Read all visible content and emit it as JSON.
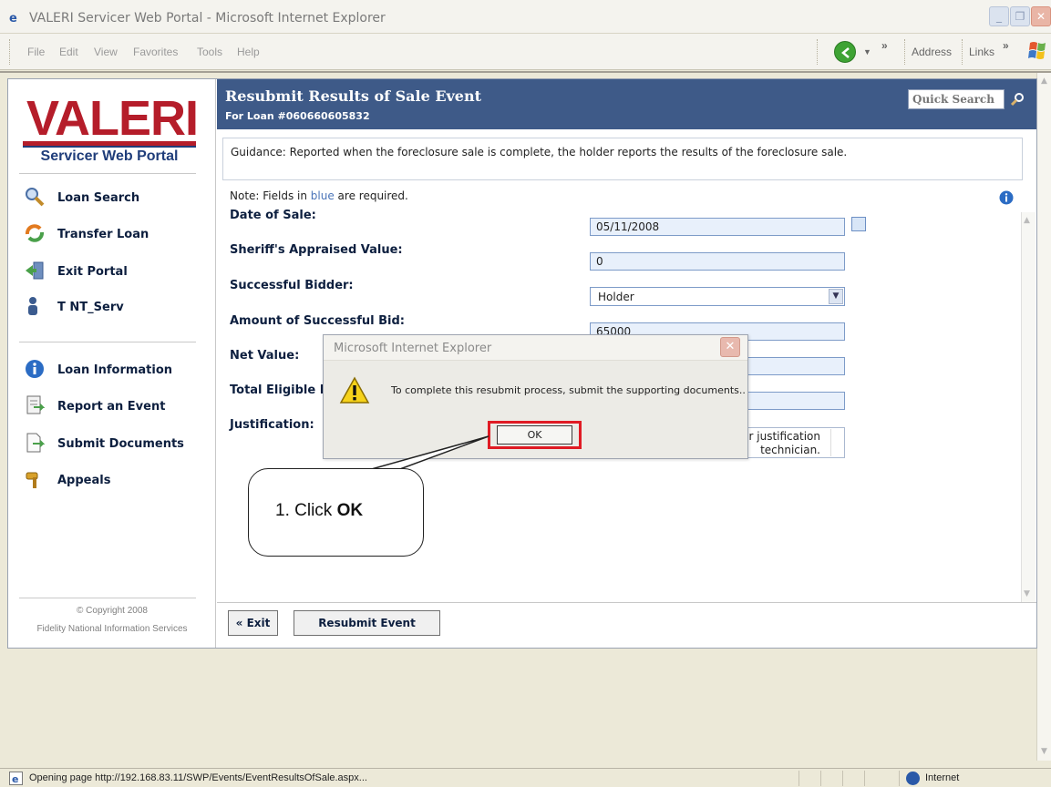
{
  "window": {
    "title": "VALERI Servicer Web Portal - Microsoft Internet Explorer"
  },
  "menubar": {
    "items": [
      "File",
      "Edit",
      "View",
      "Favorites",
      "Tools",
      "Help"
    ],
    "chevron": "»",
    "address_label": "Address",
    "links_label": "Links"
  },
  "sidebar": {
    "logo_text": "VALERI",
    "logo_subtitle": "Servicer Web Portal",
    "nav_top": [
      {
        "label": "Loan Search",
        "icon": "magnifier-icon"
      },
      {
        "label": "Transfer Loan",
        "icon": "transfer-icon"
      },
      {
        "label": "Exit Portal",
        "icon": "exit-icon"
      },
      {
        "label": "T NT_Serv",
        "icon": "user-icon"
      }
    ],
    "nav_bottom": [
      {
        "label": "Loan Information",
        "icon": "info-icon"
      },
      {
        "label": "Report an Event",
        "icon": "report-icon"
      },
      {
        "label": "Submit Documents",
        "icon": "document-icon"
      },
      {
        "label": "Appeals",
        "icon": "gavel-icon"
      }
    ],
    "copyright_line1": "© Copyright 2008",
    "copyright_line2": "Fidelity National Information Services"
  },
  "header": {
    "title": "Resubmit Results of Sale Event",
    "subtitle": "For Loan #060660605832",
    "quick_search_placeholder": "Quick Search"
  },
  "guidance": "Guidance: Reported when the foreclosure sale is complete, the holder reports the results of the foreclosure sale.",
  "note": {
    "prefix": "Note: Fields in ",
    "blue_word": "blue",
    "suffix": " are required."
  },
  "form": {
    "date_of_sale": {
      "label": "Date of Sale:",
      "value": "05/11/2008"
    },
    "appraised_value": {
      "label": "Sheriff's Appraised Value:",
      "value": "0"
    },
    "successful_bidder": {
      "label": "Successful Bidder:",
      "value": "Holder"
    },
    "amount_bid": {
      "label": "Amount of Successful Bid:",
      "value": "65000"
    },
    "net_value": {
      "label": "Net Value:",
      "value": ""
    },
    "total_eligible": {
      "label": "Total Eligible In",
      "value": ""
    },
    "justification": {
      "label": "Justification:",
      "line1": "ur justification",
      "line2": "technician."
    }
  },
  "buttons": {
    "exit": "« Exit",
    "resubmit": "Resubmit Event"
  },
  "dialog": {
    "title": "Microsoft Internet Explorer",
    "message": "To complete this resubmit process, submit the supporting documents..",
    "ok_label": "OK"
  },
  "callout": {
    "prefix": "1. Click ",
    "bold": "OK"
  },
  "statusbar": {
    "text": "Opening page http://192.168.83.11/SWP/Events/EventResultsOfSale.aspx...",
    "zone": "Internet"
  },
  "colors": {
    "header_blue": "#3e5a88",
    "logo_red": "#b51d2a",
    "highlight_red": "#e01b24"
  }
}
